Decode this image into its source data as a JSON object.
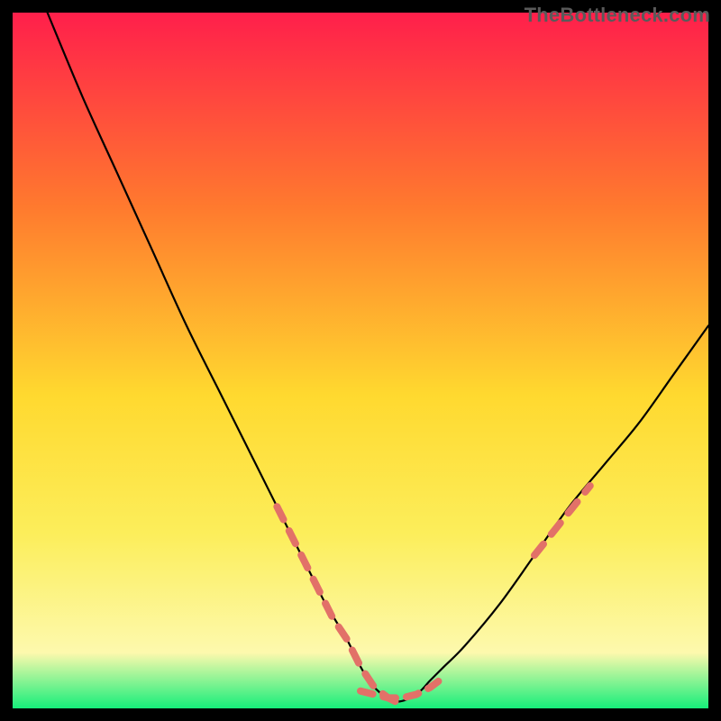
{
  "watermark": "TheBottleneck.com",
  "colors": {
    "bg_black": "#000000",
    "curve": "#000000",
    "dash": "#e27168",
    "grad_top": "#ff1f4b",
    "grad_mid_upper": "#ff7a2e",
    "grad_mid": "#ffd92f",
    "grad_mid_lower": "#fcee5b",
    "grad_pale": "#fdf9ad",
    "grad_bottom": "#16ee7a"
  },
  "chart_data": {
    "type": "line",
    "title": "",
    "xlabel": "",
    "ylabel": "",
    "xlim": [
      0,
      100
    ],
    "ylim": [
      0,
      100
    ],
    "note": "No axis ticks or numeric labels are rendered; x/y are normalized 0–100. Curve is a V-shape with minimum near x≈55, y≈0; left arm rises to y≈100 near x≈5, right arm rises to y≈55 near x≈100.",
    "series": [
      {
        "name": "bottleneck-curve",
        "style": "solid",
        "x": [
          5,
          10,
          15,
          20,
          25,
          30,
          35,
          40,
          43,
          45,
          48,
          50,
          52,
          55,
          58,
          60,
          62,
          65,
          70,
          75,
          80,
          85,
          90,
          95,
          100
        ],
        "y": [
          100,
          88,
          77,
          66,
          55,
          45,
          35,
          25,
          19,
          15,
          10,
          6,
          3,
          1,
          2,
          4,
          6,
          9,
          15,
          22,
          29,
          35,
          41,
          48,
          55
        ]
      },
      {
        "name": "left-dashed-segment",
        "style": "dashed",
        "x": [
          38,
          40,
          42,
          44,
          46,
          48,
          50,
          52,
          54,
          55
        ],
        "y": [
          29,
          25,
          21,
          17,
          13,
          10,
          6,
          3,
          1.5,
          1
        ]
      },
      {
        "name": "valley-dashed-segment",
        "style": "dashed",
        "x": [
          50,
          52,
          54,
          56,
          58,
          60,
          62
        ],
        "y": [
          2.5,
          2,
          1.5,
          1.5,
          2,
          3,
          4.5
        ]
      },
      {
        "name": "right-dashed-segment",
        "style": "dashed",
        "x": [
          75,
          77,
          79,
          81,
          83
        ],
        "y": [
          22,
          24.5,
          27,
          29.5,
          32
        ]
      }
    ]
  }
}
